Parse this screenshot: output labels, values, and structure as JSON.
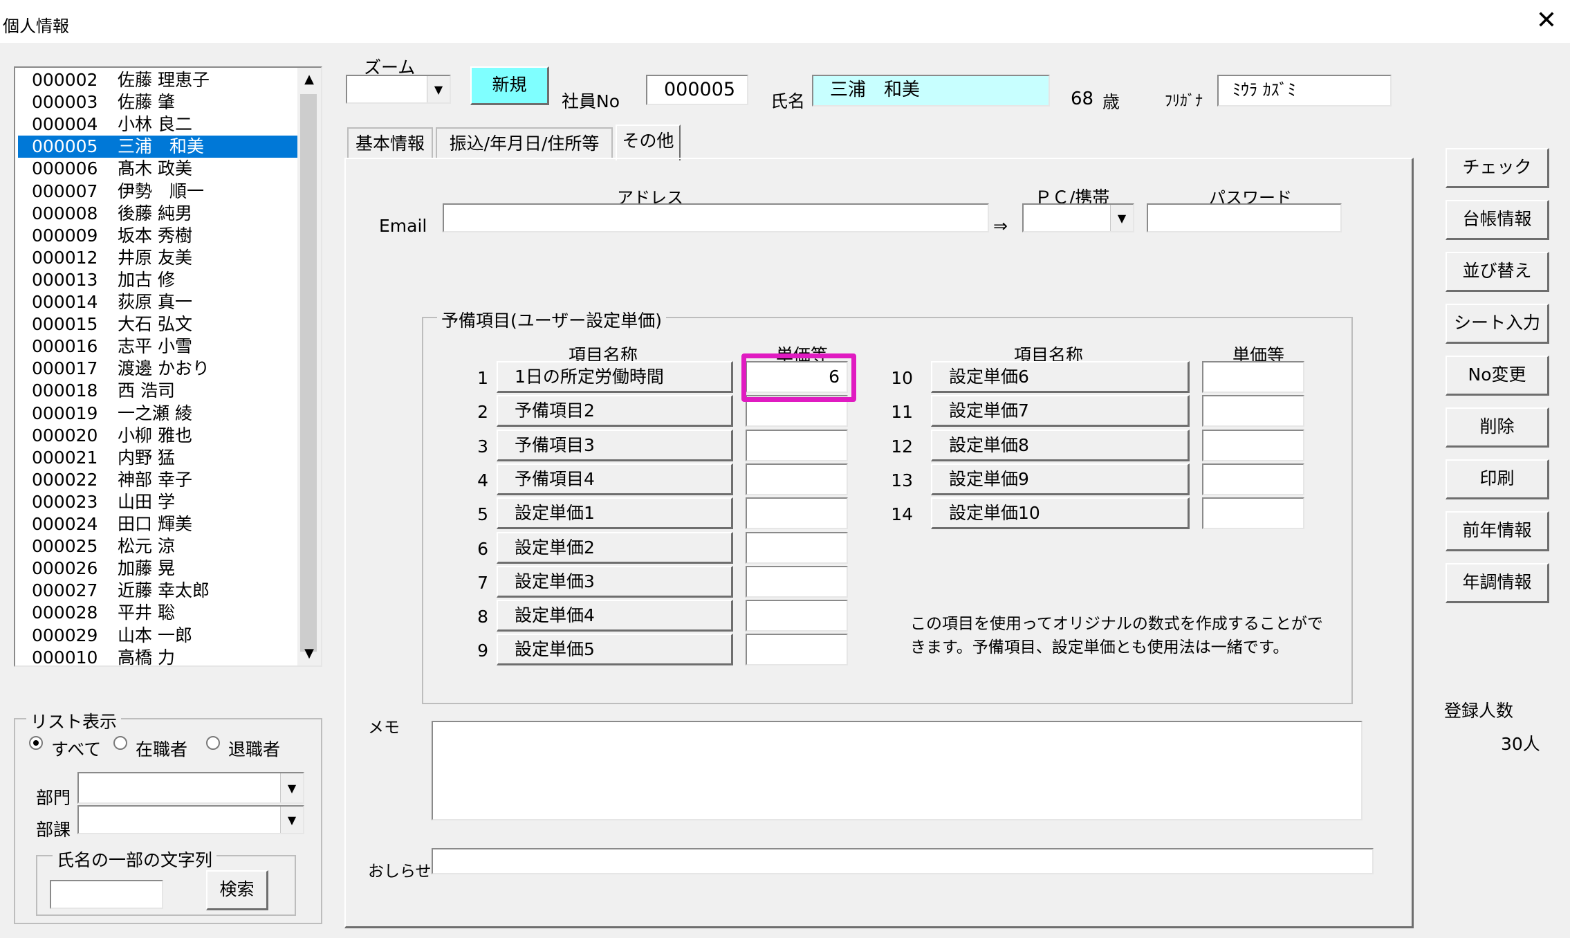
{
  "window": {
    "title": "個人情報",
    "close_label": "✕"
  },
  "employees": [
    {
      "no": "000002",
      "name": "佐藤 理恵子"
    },
    {
      "no": "000003",
      "name": "佐藤 肇"
    },
    {
      "no": "000004",
      "name": "小林 良二"
    },
    {
      "no": "000005",
      "name": "三浦　和美"
    },
    {
      "no": "000006",
      "name": "髙木 政美"
    },
    {
      "no": "000007",
      "name": "伊勢　順一"
    },
    {
      "no": "000008",
      "name": "後藤 純男"
    },
    {
      "no": "000009",
      "name": "坂本 秀樹"
    },
    {
      "no": "000012",
      "name": "井原 友美"
    },
    {
      "no": "000013",
      "name": "加古 修"
    },
    {
      "no": "000014",
      "name": "荻原 真一"
    },
    {
      "no": "000015",
      "name": "大石 弘文"
    },
    {
      "no": "000016",
      "name": "志平 小雪"
    },
    {
      "no": "000017",
      "name": "渡邊 かおり"
    },
    {
      "no": "000018",
      "name": "西 浩司"
    },
    {
      "no": "000019",
      "name": "一之瀬 綾"
    },
    {
      "no": "000020",
      "name": "小柳 雅也"
    },
    {
      "no": "000021",
      "name": "内野 猛"
    },
    {
      "no": "000022",
      "name": "神部 幸子"
    },
    {
      "no": "000023",
      "name": "山田 学"
    },
    {
      "no": "000024",
      "name": "田口 輝美"
    },
    {
      "no": "000025",
      "name": "松元 涼"
    },
    {
      "no": "000026",
      "name": "加藤 晃"
    },
    {
      "no": "000027",
      "name": "近藤 幸太郎"
    },
    {
      "no": "000028",
      "name": "平井 聡"
    },
    {
      "no": "000029",
      "name": "山本 一郎"
    },
    {
      "no": "000010",
      "name": "高橋 力"
    }
  ],
  "selected_employee_no": "000005",
  "list_filter": {
    "title": "リスト表示",
    "options": [
      "すべて",
      "在職者",
      "退職者"
    ],
    "selected": "すべて",
    "dept_label": "部門",
    "section_label": "部課",
    "dept_value": "",
    "section_value": "",
    "name_search_title": "氏名の一部の文字列",
    "name_search_value": "",
    "search_button": "検索"
  },
  "header": {
    "zoom_label": "ズーム",
    "zoom_value": "",
    "new_button": "新規",
    "emp_no_label": "社員No",
    "emp_no_value": "000005",
    "name_label": "氏名",
    "name_value": "三浦　和美",
    "age_value": "68",
    "age_unit": "歳",
    "furigana_label": "ﾌﾘｶﾞﾅ",
    "furigana_value": "ﾐｳﾗ ｶｽﾞﾐ"
  },
  "tabs": [
    "基本情報",
    "振込/年月日/住所等",
    "その他"
  ],
  "active_tab": "その他",
  "email": {
    "label": "Email",
    "address_header": "アドレス",
    "device_header": "ＰＣ/携帯",
    "password_header": "パスワード",
    "arrow": "⇒",
    "address_value": "",
    "device_value": "",
    "password_value": ""
  },
  "reserve_items": {
    "title": "予備項目(ユーザー設定単価)",
    "name_header": "項目名称",
    "unit_header": "単価等",
    "left_rows": [
      {
        "num": "1",
        "name": "1日の所定労働時間",
        "value": "6"
      },
      {
        "num": "2",
        "name": "予備項目2",
        "value": ""
      },
      {
        "num": "3",
        "name": "予備項目3",
        "value": ""
      },
      {
        "num": "4",
        "name": "予備項目4",
        "value": ""
      },
      {
        "num": "5",
        "name": "設定単価1",
        "value": ""
      },
      {
        "num": "6",
        "name": "設定単価2",
        "value": ""
      },
      {
        "num": "7",
        "name": "設定単価3",
        "value": ""
      },
      {
        "num": "8",
        "name": "設定単価4",
        "value": ""
      },
      {
        "num": "9",
        "name": "設定単価5",
        "value": ""
      }
    ],
    "right_rows": [
      {
        "num": "10",
        "name": "設定単価6",
        "value": ""
      },
      {
        "num": "11",
        "name": "設定単価7",
        "value": ""
      },
      {
        "num": "12",
        "name": "設定単価8",
        "value": ""
      },
      {
        "num": "13",
        "name": "設定単価9",
        "value": ""
      },
      {
        "num": "14",
        "name": "設定単価10",
        "value": ""
      }
    ],
    "note_line1": "この項目を使用ってオリジナルの数式を作成することがで",
    "note_line2": "きます。予備項目、設定単価とも使用法は一緒です。"
  },
  "memo": {
    "label": "メモ",
    "value": ""
  },
  "notice": {
    "label": "おしらせ",
    "value": ""
  },
  "side_buttons": [
    "チェック",
    "台帳情報",
    "並び替え",
    "シート入力",
    "No変更",
    "削除",
    "印刷",
    "前年情報",
    "年調情報"
  ],
  "registered": {
    "label": "登録人数",
    "count": "30人"
  },
  "colors": {
    "selection": "#0078d7",
    "highlight": "#e01bc1",
    "name_field": "#c8ffff",
    "new_button": "#7fffff"
  }
}
